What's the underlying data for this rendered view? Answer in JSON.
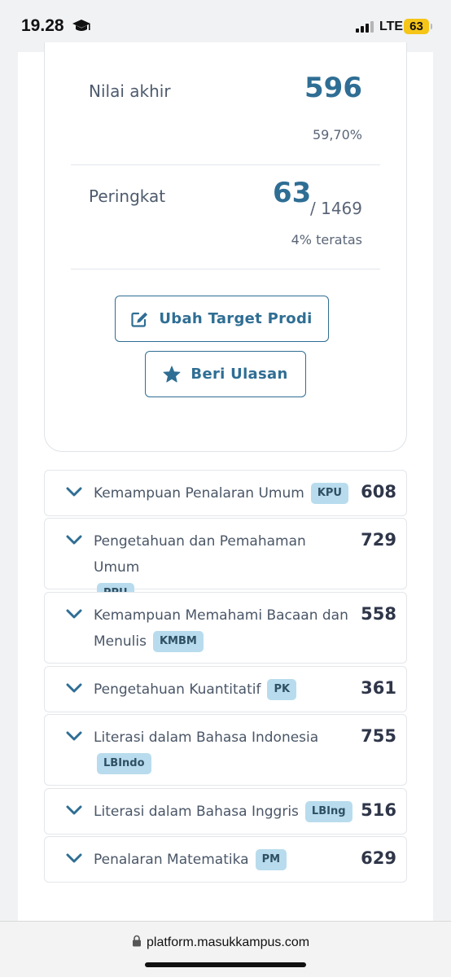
{
  "status": {
    "time": "19.28",
    "network": "LTE",
    "battery": "63"
  },
  "result": {
    "final_label": "Nilai akhir",
    "final_score": "596",
    "final_percent": "59,70%",
    "rank_label": "Peringkat",
    "rank_value": "63",
    "rank_total": "/ 1469",
    "rank_note": "4% teratas",
    "edit_target_label": "Ubah Target Prodi",
    "review_label": "Beri Ulasan"
  },
  "subtests": [
    {
      "name": "Kemampuan Penalaran Umum",
      "code": "KPU",
      "score": "608"
    },
    {
      "name": "Pengetahuan dan Pemahaman Umum",
      "code": "PPU",
      "score": "729"
    },
    {
      "name": "Kemampuan Memahami Bacaan dan Menulis",
      "code": "KMBM",
      "score": "558"
    },
    {
      "name": "Pengetahuan Kuantitatif",
      "code": "PK",
      "score": "361"
    },
    {
      "name": "Literasi dalam Bahasa Indonesia",
      "code": "LBIndo",
      "score": "755"
    },
    {
      "name": "Literasi dalam Bahasa Inggris",
      "code": "LBIng",
      "score": "516"
    },
    {
      "name": "Penalaran Matematika",
      "code": "PM",
      "score": "629"
    }
  ],
  "browser": {
    "url": "platform.masukkampus.com"
  },
  "colors": {
    "accent": "#2f6e94",
    "tag_bg": "#b8dced",
    "score": "#2f3649"
  }
}
